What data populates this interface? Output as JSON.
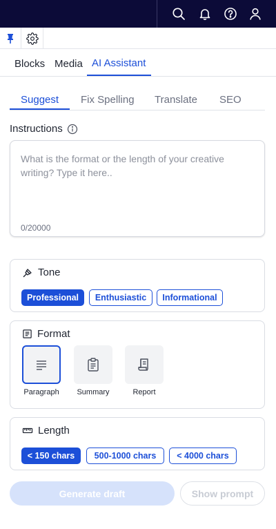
{
  "topbar": {
    "icons": [
      "search-icon",
      "bell-icon",
      "help-icon",
      "user-icon"
    ]
  },
  "toolbar": {
    "icons": [
      "pin-icon",
      "gear-icon"
    ]
  },
  "main_tabs": [
    {
      "label": "Blocks",
      "active": false
    },
    {
      "label": "Media",
      "active": false
    },
    {
      "label": "AI Assistant",
      "active": true
    }
  ],
  "sub_tabs": [
    {
      "label": "Suggest",
      "active": true
    },
    {
      "label": "Fix Spelling",
      "active": false
    },
    {
      "label": "Translate",
      "active": false
    },
    {
      "label": "SEO",
      "active": false
    }
  ],
  "instructions": {
    "label": "Instructions",
    "placeholder": "What is the format or the length of your creative writing? Type it here..",
    "value": "",
    "counter": "0/20000"
  },
  "tone": {
    "title": "Tone",
    "options": [
      "Professional",
      "Enthusiastic",
      "Informational"
    ],
    "selected": "Professional"
  },
  "format": {
    "title": "Format",
    "options": [
      "Paragraph",
      "Summary",
      "Report"
    ],
    "selected": "Paragraph"
  },
  "length": {
    "title": "Length",
    "options": [
      "< 150 chars",
      "500-1000 chars",
      "< 4000 chars"
    ],
    "selected": "< 150 chars"
  },
  "actions": {
    "generate_label": "Generate draft",
    "prompt_label": "Show prompt"
  },
  "colors": {
    "topbar_bg": "#0c0b38",
    "accent": "#1c4fd8",
    "disabled_primary": "#d6e2fb"
  }
}
